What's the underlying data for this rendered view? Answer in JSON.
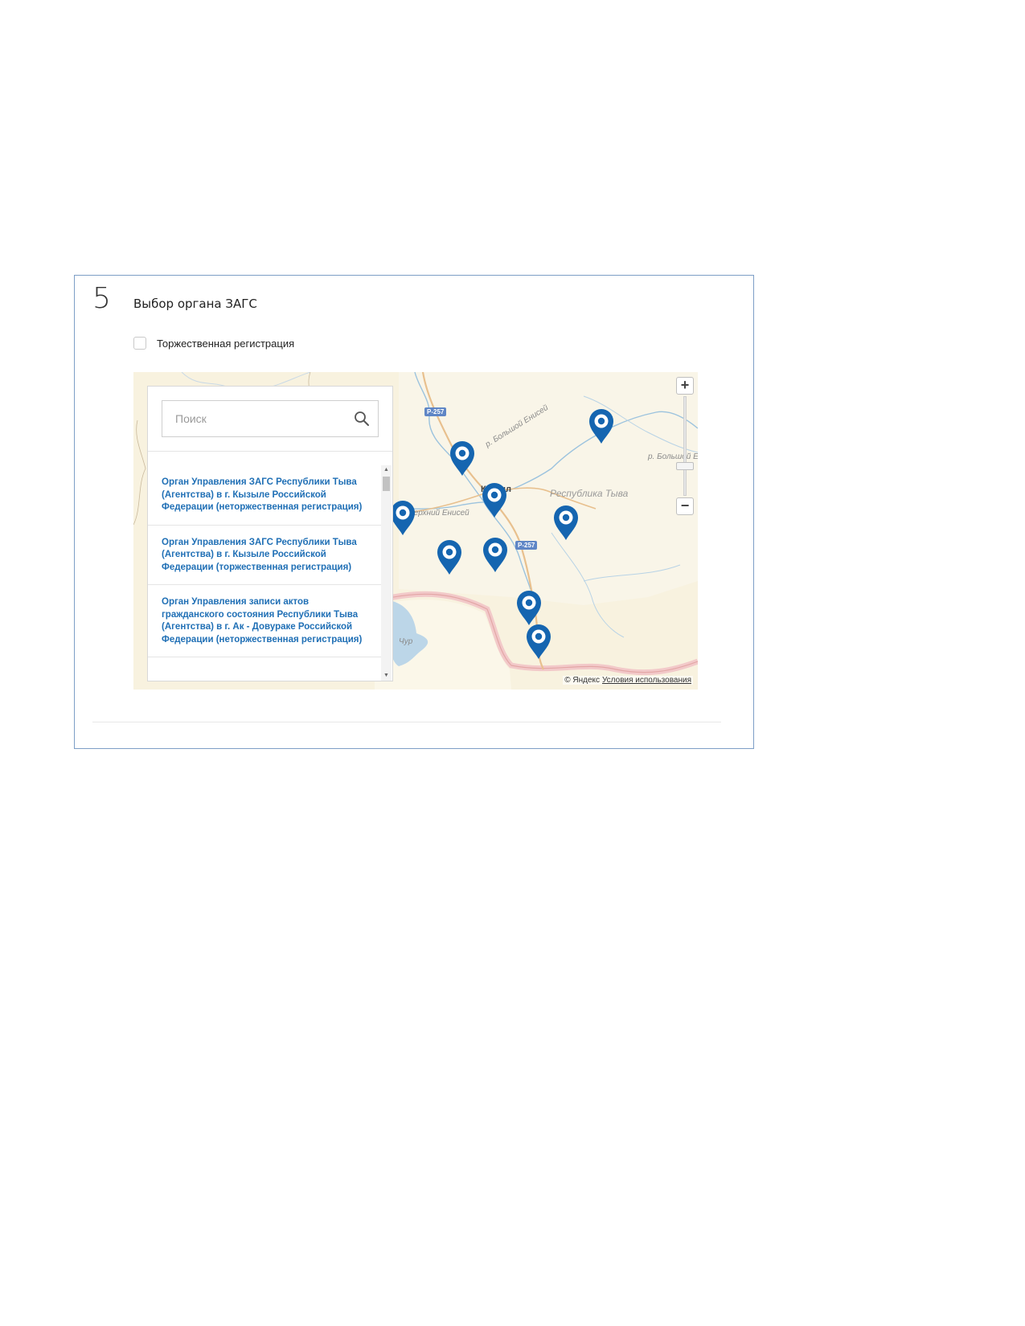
{
  "step": {
    "number": "5",
    "title": "Выбор органа ЗАГС"
  },
  "checkbox": {
    "label": "Торжественная регистрация",
    "checked": false
  },
  "search": {
    "placeholder": "Поиск"
  },
  "list": {
    "items": [
      "Орган Управления ЗАГС Республики Тыва (Агентства) в г. Кызыле Российской Федерации (неторжественная регистрация)",
      "Орган Управления ЗАГС Республики Тыва (Агентства) в г. Кызыле Российской Федерации (торжественная регистрация)",
      "Орган Управления записи актов гражданского состояния Республики Тыва (Агентства) в г. Ак - Довураке Российской Федерации (неторжественная регистрация)"
    ]
  },
  "map": {
    "region_label": "Республика Тыва",
    "river_labels": [
      "р. Большой Енисей",
      "р. Большой Ени",
      "Верхний Енисей"
    ],
    "lake_label": "Чур",
    "road_badges": [
      "Р-257",
      "Р-257"
    ],
    "city_label": "Кызыл",
    "copyright": "© Яндекс",
    "terms_link": "Условия использования",
    "zoom_in": "+",
    "zoom_out": "−",
    "pin_color": "#1565b0",
    "pin_count": 10
  },
  "colors": {
    "accent": "#1f6fb5",
    "frame_border": "#7d9ec6"
  }
}
